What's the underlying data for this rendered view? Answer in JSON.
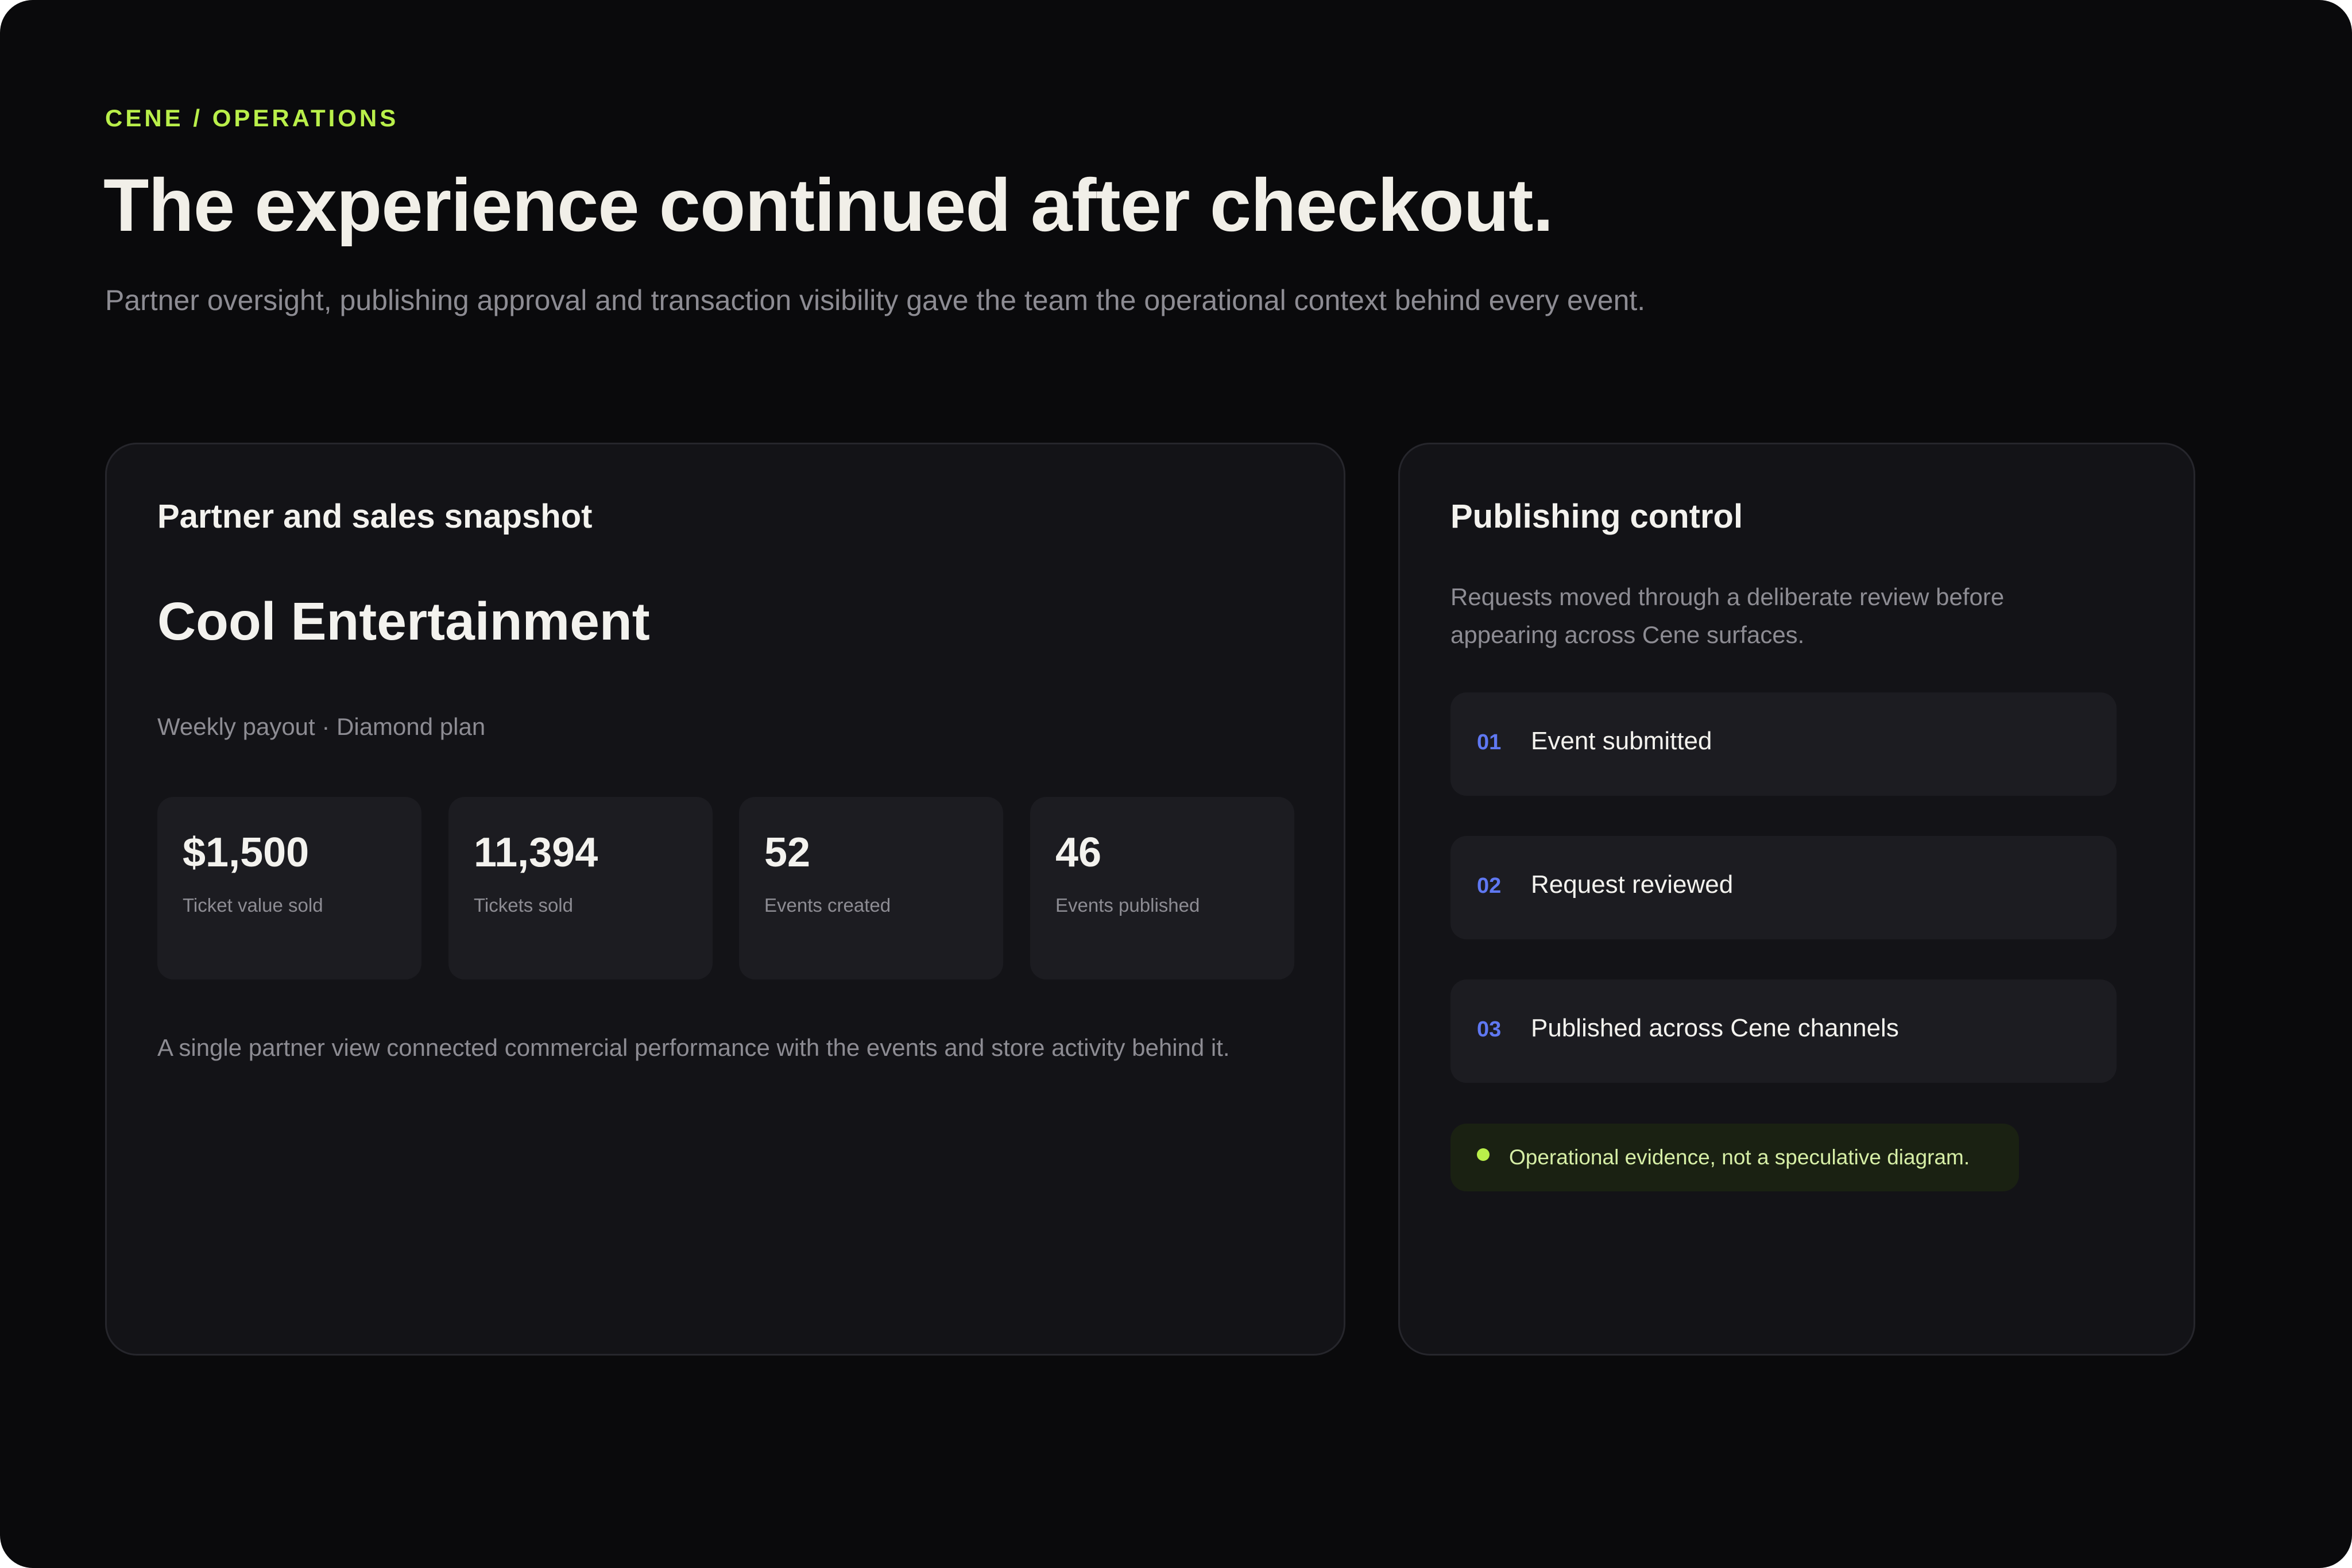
{
  "header": {
    "eyebrow": "CENE / OPERATIONS",
    "title": "The experience continued after checkout.",
    "lede": "Partner oversight, publishing approval and transaction visibility gave the team the operational context behind every event."
  },
  "snapshot": {
    "title": "Partner and sales snapshot",
    "partner_name": "Cool Entertainment",
    "partner_meta": "Weekly payout · Diamond plan",
    "stats": [
      {
        "value": "$1,500",
        "label": "Ticket value sold"
      },
      {
        "value": "11,394",
        "label": "Tickets sold"
      },
      {
        "value": "52",
        "label": "Events created"
      },
      {
        "value": "46",
        "label": "Events published"
      }
    ],
    "note": "A single partner view connected commercial performance with the events and store activity behind it."
  },
  "publishing": {
    "title": "Publishing control",
    "description": "Requests moved through a deliberate review before appearing across Cene surfaces.",
    "steps": [
      {
        "number": "01",
        "label": "Event submitted"
      },
      {
        "number": "02",
        "label": "Request reviewed"
      },
      {
        "number": "03",
        "label": "Published across Cene channels"
      }
    ],
    "evidence": "Operational evidence, not a speculative diagram."
  },
  "colors": {
    "background": "#0a0a0c",
    "card": "#131317",
    "accent_lime": "#b9ef4a",
    "accent_blue": "#5f78f2",
    "text_primary": "#f3f2ee",
    "text_muted": "#8d8c93"
  }
}
